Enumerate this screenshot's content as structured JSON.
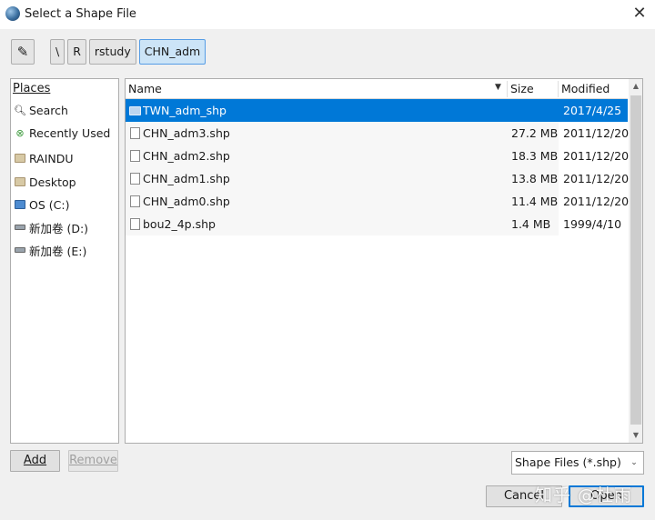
{
  "window": {
    "title": "Select a Shape File"
  },
  "pathbar": {
    "crumbs": [
      "\\",
      "R",
      "rstudy",
      "CHN_adm"
    ]
  },
  "places": {
    "header": "Places",
    "items": [
      {
        "label": "Search",
        "icon": "search-icon"
      },
      {
        "label": "Recently Used",
        "icon": "recent-icon"
      },
      {
        "label": "RAINDU",
        "icon": "folder-icon"
      },
      {
        "label": "Desktop",
        "icon": "folder-icon"
      },
      {
        "label": "OS (C:)",
        "icon": "drive-icon"
      },
      {
        "label": "新加卷 (D:)",
        "icon": "drive-icon"
      },
      {
        "label": "新加卷 (E:)",
        "icon": "drive-icon"
      }
    ]
  },
  "files": {
    "columns": {
      "name": "Name",
      "size": "Size",
      "modified": "Modified"
    },
    "rows": [
      {
        "name": "TWN_adm_shp",
        "size": "",
        "modified": "2017/4/25",
        "type": "folder"
      },
      {
        "name": "CHN_adm3.shp",
        "size": "27.2 MB",
        "modified": "2011/12/20",
        "type": "file"
      },
      {
        "name": "CHN_adm2.shp",
        "size": "18.3 MB",
        "modified": "2011/12/20",
        "type": "file"
      },
      {
        "name": "CHN_adm1.shp",
        "size": "13.8 MB",
        "modified": "2011/12/20",
        "type": "file"
      },
      {
        "name": "CHN_adm0.shp",
        "size": "11.4 MB",
        "modified": "2011/12/20",
        "type": "file"
      },
      {
        "name": "bou2_4p.shp",
        "size": "1.4 MB",
        "modified": "1999/4/10",
        "type": "file"
      }
    ]
  },
  "buttons": {
    "add": "Add",
    "remove": "Remove",
    "cancel": "Cancel",
    "open": "Open"
  },
  "filter": {
    "selected": "Shape Files (*.shp)"
  },
  "watermark": "知乎 @杜雨",
  "colors": {
    "selection": "#0078d7",
    "active_crumb": "#cce4f7"
  }
}
